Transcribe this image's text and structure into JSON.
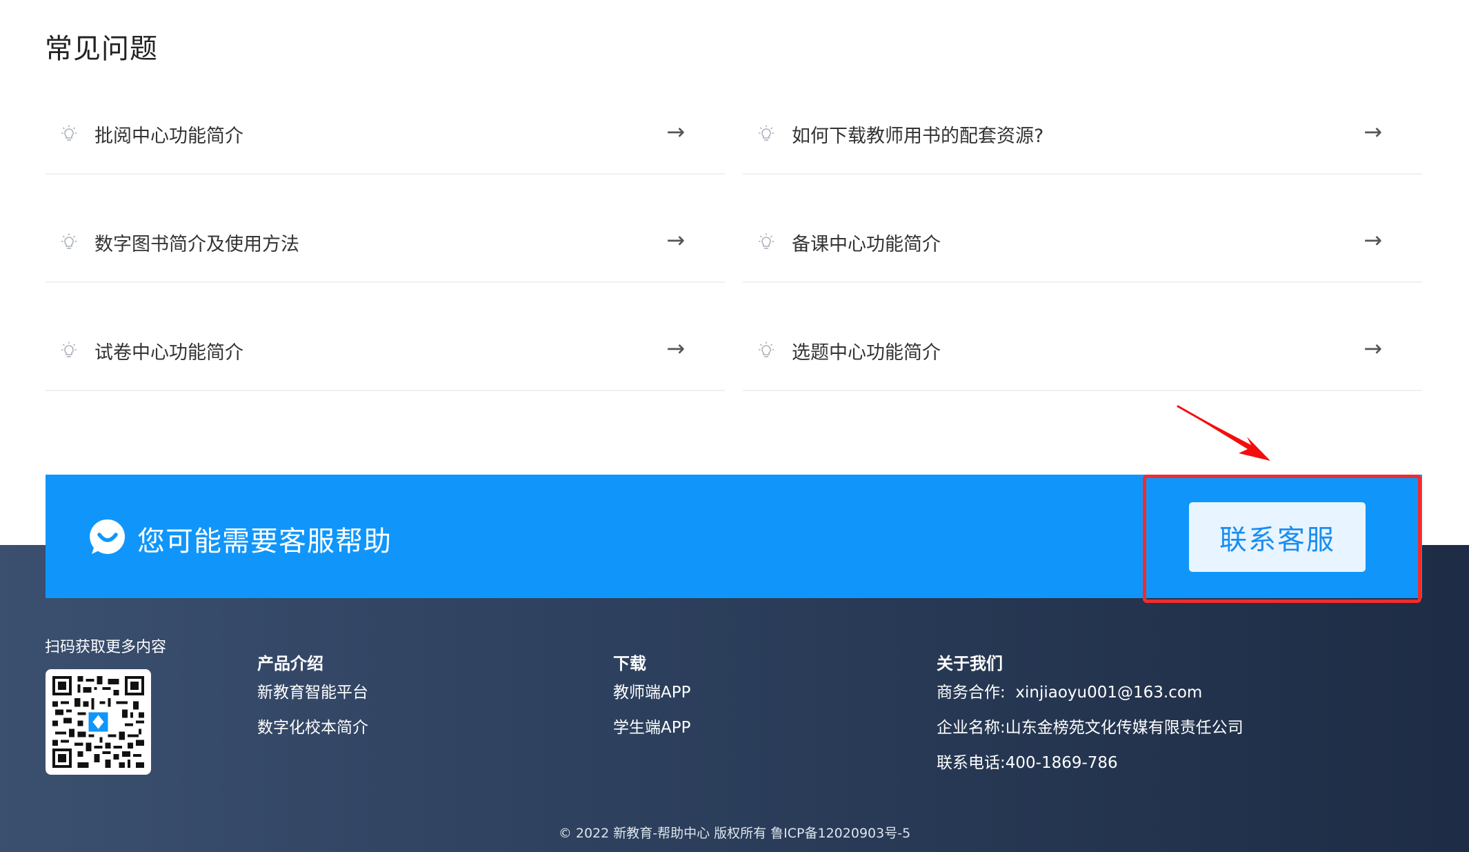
{
  "faq": {
    "title": "常见问题",
    "items": [
      {
        "label": "批阅中心功能简介"
      },
      {
        "label": "如何下载教师用书的配套资源?"
      },
      {
        "label": "数字图书简介及使用方法"
      },
      {
        "label": "备课中心功能简介"
      },
      {
        "label": "试卷中心功能简介"
      },
      {
        "label": "选题中心功能简介"
      }
    ],
    "arrow": "→"
  },
  "help": {
    "text": "您可能需要客服帮助",
    "button": "联系客服"
  },
  "footer": {
    "qr_caption": "扫码获取更多内容",
    "product": {
      "title": "产品介绍",
      "items": [
        "新教育智能平台",
        "数字化校本简介"
      ]
    },
    "download": {
      "title": "下载",
      "items": [
        "教师端APP",
        "学生端APP"
      ]
    },
    "about": {
      "title": "关于我们",
      "rows": [
        {
          "key": "商务合作:",
          "value": "  xinjiaoyu001@163.com"
        },
        {
          "key": "企业名称:",
          "value": "山东金榜苑文化传媒有限责任公司"
        },
        {
          "key": "联系电话:",
          "value": "400-1869-786"
        }
      ]
    },
    "copyright": "© 2022 新教育-帮助中心 版权所有 鲁ICP备12020903号-5"
  },
  "colors": {
    "banner_blue": "#1096fb",
    "highlight_red": "#f12c2c",
    "footer_dark": "#2c3f5c"
  }
}
